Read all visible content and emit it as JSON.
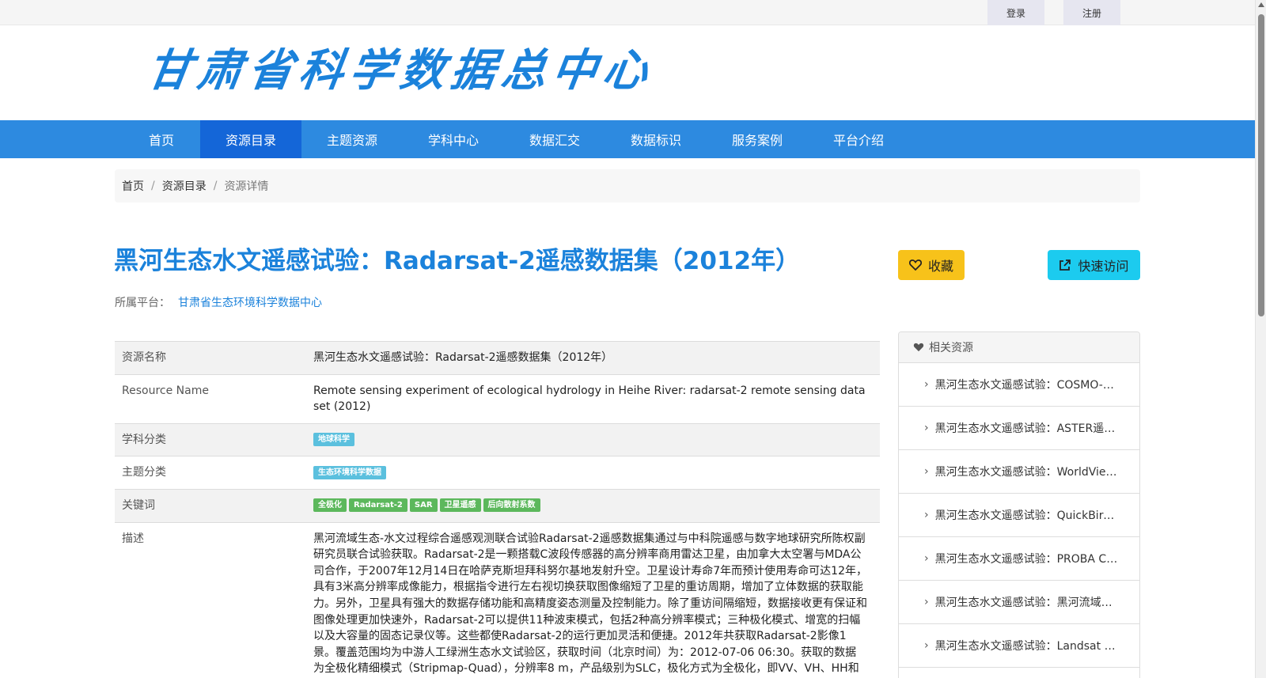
{
  "topbar": {
    "login": "登录",
    "register": "注册"
  },
  "header": {
    "logo_text": "甘肃省科学数据总中心"
  },
  "nav": {
    "items": [
      {
        "label": "首页"
      },
      {
        "label": "资源目录"
      },
      {
        "label": "主题资源"
      },
      {
        "label": "学科中心"
      },
      {
        "label": "数据汇交"
      },
      {
        "label": "数据标识"
      },
      {
        "label": "服务案例"
      },
      {
        "label": "平台介绍"
      }
    ],
    "active": "资源目录"
  },
  "breadcrumb": {
    "home": "首页",
    "catalog": "资源目录",
    "current": "资源详情"
  },
  "resource": {
    "title": "黑河生态水文遥感试验：Radarsat-2遥感数据集（2012年）",
    "platform_label": "所属平台：",
    "platform_name": "甘肃省生态环境科学数据中心",
    "fav_label": "收藏",
    "visit_label": "快速访问"
  },
  "info": {
    "name_label": "资源名称",
    "name_value": "黑河生态水文遥感试验：Radarsat-2遥感数据集（2012年）",
    "en_label": "Resource Name",
    "en_value": "Remote sensing experiment of ecological hydrology in Heihe River: radarsat-2 remote sensing data set (2012)",
    "subject_label": "学科分类",
    "subject_tag": "地球科学",
    "theme_label": "主题分类",
    "theme_tag": "生态环境科学数据",
    "keywords_label": "关键词",
    "keywords": [
      "全极化",
      "Radarsat-2",
      "SAR",
      "卫星遥感",
      "后向散射系数"
    ],
    "desc_label": "描述",
    "desc_value": "黑河流域生态-水文过程综合遥感观测联合试验Radarsat-2遥感数据集通过与中科院遥感与数字地球研究所陈权副研究员联合试验获取。Radarsat-2是一颗搭载C波段传感器的高分辨率商用雷达卫星，由加拿大太空署与MDA公司合作，于2007年12月14日在哈萨克斯坦拜科努尔基地发射升空。卫星设计寿命7年而预计使用寿命可达12年，具有3米高分辨率成像能力，根据指令进行左右视切换获取图像缩短了卫星的重访周期，增加了立体数据的获取能力。另外，卫星具有强大的数据存储功能和高精度姿态测量及控制能力。除了重访间隔缩短，数据接收更有保证和图像处理更加快速外，Radarsat-2可以提供11种波束模式，包括2种高分辨率模式；三种极化模式、增宽的扫幅以及大容量的固态记录仪等。这些都使Radarsat-2的运行更加灵活和便捷。2012年共获取Radarsat-2影像1景。覆盖范围均为中游人工绿洲生态水文试验区，获取时间（北京时间）为：2012-07-06 06:30。获取的数据为全极化精细模式（Stripmap-Quad），分辨率8 m，产品级别为SLC，极化方式为全极化，即VV、VH、HH和HV。"
  },
  "related": {
    "heading": "相关资源",
    "items": [
      "黑河生态水文遥感试验：COSMO-SkyMed遥感数据集",
      "黑河生态水文遥感试验：ASTER遥感数据集",
      "黑河生态水文遥感试验：WorldView遥感数据集",
      "黑河生态水文遥感试验：QuickBird遥感数据集",
      "黑河生态水文遥感试验：PROBA CHRIS遥感数据集",
      "黑河生态水文遥感试验：黑河流域遥感数据集",
      "黑河生态水文遥感试验：Landsat 遥感数据集"
    ]
  },
  "colors": {
    "brand_blue": "#1b82db",
    "nav_bg": "#2d8ae0",
    "nav_active": "#1466d8",
    "fav_btn": "#f7c21a",
    "visit_btn": "#1ccbef",
    "tag_blue": "#5bc0de",
    "tag_green": "#5cb85c"
  },
  "icons": {
    "fav": "heart-outline-icon",
    "visit": "external-link-icon",
    "related": "heart-icon",
    "related_item": "chevron-right-icon"
  }
}
